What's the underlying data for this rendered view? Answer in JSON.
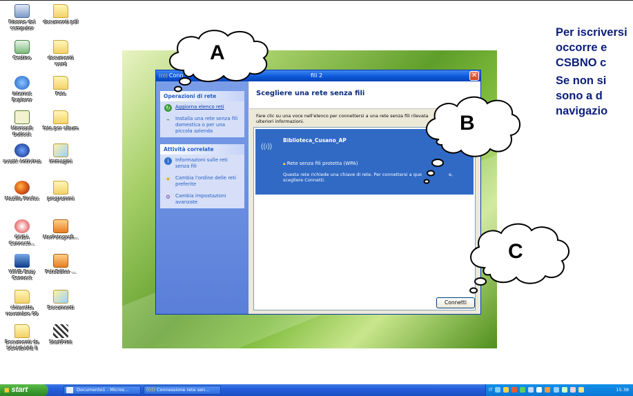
{
  "desktop_icons": [
    {
      "label": "Risorse del computer",
      "icon": "computer-icon"
    },
    {
      "label": "documenti pdf",
      "icon": "folder-icon"
    },
    {
      "label": "Cestino",
      "icon": "recycle-bin-icon"
    },
    {
      "label": "documenti word",
      "icon": "folder-icon"
    },
    {
      "label": "Internet Explorer",
      "icon": "ie-icon"
    },
    {
      "label": "Foto",
      "icon": "folder-icon"
    },
    {
      "label": "Microsoft Outlook",
      "icon": "outlook-icon"
    },
    {
      "label": "foto per album",
      "icon": "folder-icon"
    },
    {
      "label": "avast! Antivirus",
      "icon": "avast-icon"
    },
    {
      "label": "immagini",
      "icon": "image-folder-icon"
    },
    {
      "label": "Mozilla Firefox",
      "icon": "firefox-icon"
    },
    {
      "label": "programmi",
      "icon": "folder-icon"
    },
    {
      "label": "ONDA Connecti...",
      "icon": "onda-icon"
    },
    {
      "label": "MorFotografi...",
      "icon": "app-icon"
    },
    {
      "label": "WIND Easy Connect",
      "icon": "wind-icon"
    },
    {
      "label": "FotoEditor ...",
      "icon": "app-icon"
    },
    {
      "label": "chiavetta novembre 09",
      "icon": "folder-icon"
    },
    {
      "label": "Documenti",
      "icon": "documents-icon"
    },
    {
      "label": "Documenti da SCANDARE ll",
      "icon": "folder-icon"
    },
    {
      "label": "StartPrint",
      "icon": "flag-icon"
    }
  ],
  "dialog": {
    "title": "Connessione rete senza fili 2",
    "title_visible": "Conn",
    "title_tail": "fili 2",
    "sidebar": {
      "network_tasks_header": "Operazioni di rete",
      "network_tasks": [
        {
          "label": "Aggiorna elenco reti",
          "icon": "refresh-icon"
        },
        {
          "label": "Installa una rete senza fili domestica o per una piccola azienda",
          "icon": "network-setup-icon"
        }
      ],
      "related_tasks_header": "Attività correlate",
      "related_tasks": [
        {
          "label": "Informazioni sulle reti senza fili",
          "icon": "info-icon"
        },
        {
          "label": "Cambia l'ordine delle reti preferite",
          "icon": "star-icon"
        },
        {
          "label": "Cambia impostazioni avanzate",
          "icon": "gear-icon"
        }
      ]
    },
    "heading": "Scegliere una rete senza fili",
    "description": "Fare clic su una voce nell'elenco per connettersi a una rete senza fili rilevata o per ulteriori informazioni.",
    "description_visible": "Fare clic su una voce nell'elenco per connettersi a una rete senza fili rilevata",
    "description_line2": "ulteriori informazioni.",
    "network": {
      "ssid": "Biblioteca_Cusano_AP",
      "security": "Rete senza fili protetta (WPA)",
      "message_line1": "Questa rete richiede una chiave di rete. Per connettersi a que",
      "message_tail": "e,",
      "message_line2": "scegliere Connetti."
    },
    "connect_button": "Connetti"
  },
  "callouts": {
    "a": "A",
    "b": "B",
    "c": "C"
  },
  "instructions": {
    "line1": "Per iscriversi",
    "line2": "occorre e",
    "line3": "CSBNO c",
    "line4": "Se non si",
    "line5": "sono a d",
    "line6": "navigazio"
  },
  "taskbar": {
    "start_label": "start",
    "tasks": [
      {
        "label": "Documento1 - Micros...",
        "icon": "word-icon"
      },
      {
        "label": "Connessione rete sen...",
        "icon": "wireless-icon"
      }
    ],
    "tray_lang": "IT",
    "clock": "15.38"
  },
  "colors": {
    "instruction_text": "#0b1d7a",
    "xp_blue": "#0a55d8",
    "selection_blue": "#316ac5",
    "start_green": "#3a9a2e"
  }
}
